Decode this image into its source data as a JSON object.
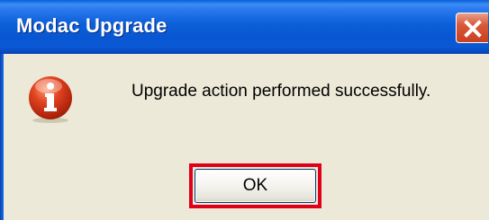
{
  "window": {
    "title": "Modac Upgrade",
    "close_icon": "close-icon"
  },
  "dialog": {
    "icon": "info-icon",
    "message": "Upgrade action performed successfully.",
    "ok_label": "OK"
  },
  "colors": {
    "titlebar_blue": "#0b5fd9",
    "dialog_background": "#ece9d8",
    "close_button_red": "#d9583a",
    "highlight_red": "#e0001a",
    "info_icon_red": "#d4391c"
  }
}
